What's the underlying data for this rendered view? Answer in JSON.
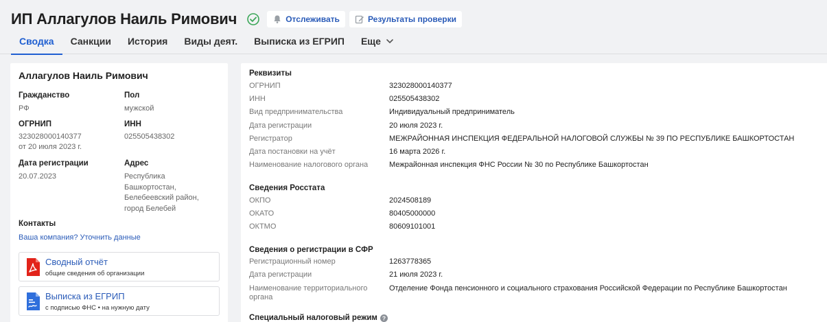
{
  "header": {
    "title": "ИП Аллагулов Наиль Римович",
    "track_label": "Отслеживать",
    "check_label": "Результаты проверки"
  },
  "tabs": [
    {
      "label": "Сводка",
      "active": true
    },
    {
      "label": "Санкции"
    },
    {
      "label": "История"
    },
    {
      "label": "Виды деят."
    },
    {
      "label": "Выписка из ЕГРИП"
    },
    {
      "label": "Еще"
    }
  ],
  "summary": {
    "name": "Аллагулов Наиль Римович",
    "citizenship_label": "Гражданство",
    "citizenship_value": "РФ",
    "sex_label": "Пол",
    "sex_value": "мужской",
    "ogrnip_label": "ОГРНИП",
    "ogrnip_value": "323028000140377",
    "ogrnip_date": "от 20 июля 2023 г.",
    "inn_label": "ИНН",
    "inn_value": "025505438302",
    "regdate_label": "Дата регистрации",
    "regdate_value": "20.07.2023",
    "address_label": "Адрес",
    "address_lines": [
      "Республика",
      "Башкортостан,",
      "Белебеевский район,",
      "город Белебей"
    ],
    "contacts_label": "Контакты",
    "contacts_link": "Ваша компания? Уточнить данные",
    "doc1_title": "Сводный отчёт",
    "doc1_sub": "общие сведения об организации",
    "doc2_title": "Выписка из ЕГРИП",
    "doc2_sub": "с подписью ФНС • на нужную дату"
  },
  "details": {
    "requisites_title": "Реквизиты",
    "requisites": [
      {
        "label": "ОГРНИП",
        "value": "323028000140377"
      },
      {
        "label": "ИНН",
        "value": "025505438302"
      },
      {
        "label": "Вид предпринимательства",
        "value": "Индивидуальный предприниматель"
      },
      {
        "label": "Дата регистрации",
        "value": "20 июля 2023 г."
      },
      {
        "label": "Регистратор",
        "value": "МЕЖРАЙОННАЯ ИНСПЕКЦИЯ ФЕДЕРАЛЬНОЙ НАЛОГОВОЙ СЛУЖБЫ № 39 ПО РЕСПУБЛИКЕ БАШКОРТОСТАН"
      },
      {
        "label": "Дата постановки на учёт",
        "value": "16 марта 2026 г."
      },
      {
        "label": "Наименование налогового органа",
        "value": "Межрайонная инспекция ФНС России № 30 по Республике Башкортостан"
      }
    ],
    "rosstat_title": "Сведения Росстата",
    "rosstat": [
      {
        "label": "ОКПО",
        "value": "2024508189"
      },
      {
        "label": "ОКАТО",
        "value": "80405000000"
      },
      {
        "label": "ОКТМО",
        "value": "80609101001"
      }
    ],
    "sfr_title": "Сведения о регистрации в СФР",
    "sfr": [
      {
        "label": "Регистрационный номер",
        "value": "1263778365"
      },
      {
        "label": "Дата регистрации",
        "value": "21 июля 2023 г."
      },
      {
        "label_line1": "Наименование территориального",
        "label_line2": "органа",
        "value": "Отделение Фонда пенсионного и социального страхования Российской Федерации по Республике Башкортостан"
      }
    ],
    "tax_title": "Специальный налоговый режим"
  },
  "colors": {
    "accent": "#1f5fd1",
    "link": "#2a5bb8",
    "success": "#3aa657",
    "pdf_red": "#e2231a",
    "doc_blue": "#2f6fdc"
  }
}
